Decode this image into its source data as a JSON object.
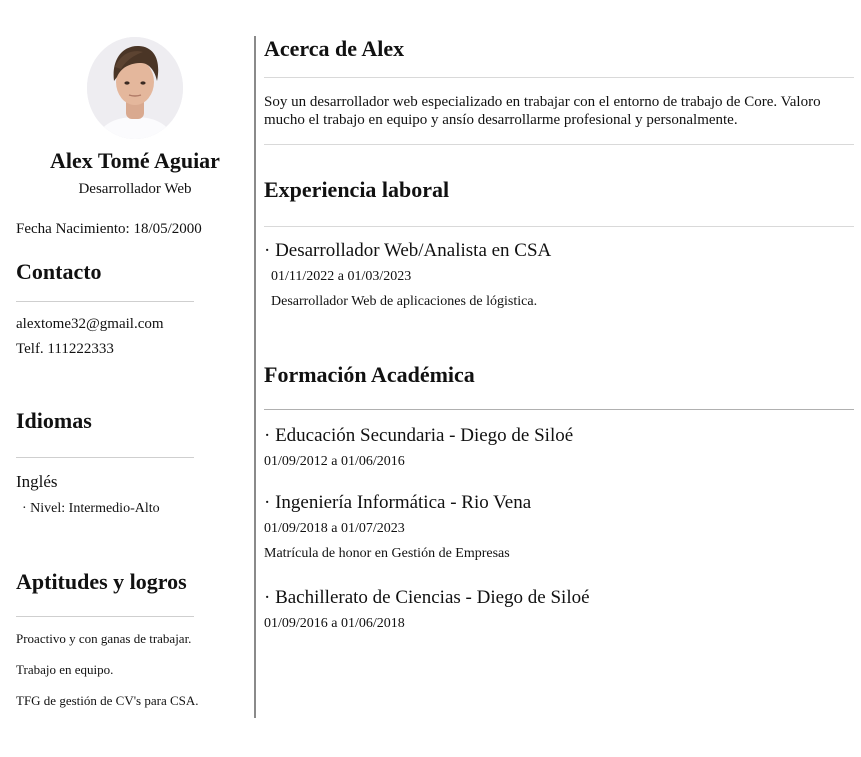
{
  "profile": {
    "name": "Alex Tomé Aguiar",
    "role": "Desarrollador Web",
    "birth": "Fecha Nacimiento: 18/05/2000"
  },
  "contact": {
    "heading": "Contacto",
    "email": "alextome32@gmail.com",
    "phone": "Telf. 111222333"
  },
  "languages": {
    "heading": "Idiomas",
    "items": [
      {
        "name": "Inglés",
        "level": "· Nivel: Intermedio-Alto"
      }
    ]
  },
  "skills": {
    "heading": "Aptitudes y logros",
    "items": [
      "Proactivo y con ganas de trabajar.",
      "Trabajo en equipo.",
      "TFG de gestión de CV's para CSA."
    ]
  },
  "about": {
    "heading": "Acerca de Alex",
    "text": "Soy un desarrollador web especializado en trabajar con el entorno de trabajo de Core. Valoro mucho el trabajo en equipo y ansío desarrollarme profesional y personalmente."
  },
  "experience": {
    "heading": "Experiencia laboral",
    "items": [
      {
        "title": "· Desarrollador Web/Analista en CSA",
        "dates": "01/11/2022 a 01/03/2023",
        "desc": "Desarrollador Web de aplicaciones de lógistica."
      }
    ]
  },
  "education": {
    "heading": "Formación Académica",
    "items": [
      {
        "title": "· Educación Secundaria - Diego de Siloé",
        "dates": "01/09/2012 a 01/06/2016"
      },
      {
        "title": "· Ingeniería Informática - Rio Vena",
        "dates": "01/09/2018 a 01/07/2023",
        "desc": "Matrícula de honor en Gestión de Empresas"
      },
      {
        "title": "· Bachillerato de Ciencias - Diego de Siloé",
        "dates": "01/09/2016 a 01/06/2018"
      }
    ]
  },
  "colors": {
    "divider": "#8a8a8a",
    "rule": "#cfcfcf",
    "text": "#111111"
  }
}
